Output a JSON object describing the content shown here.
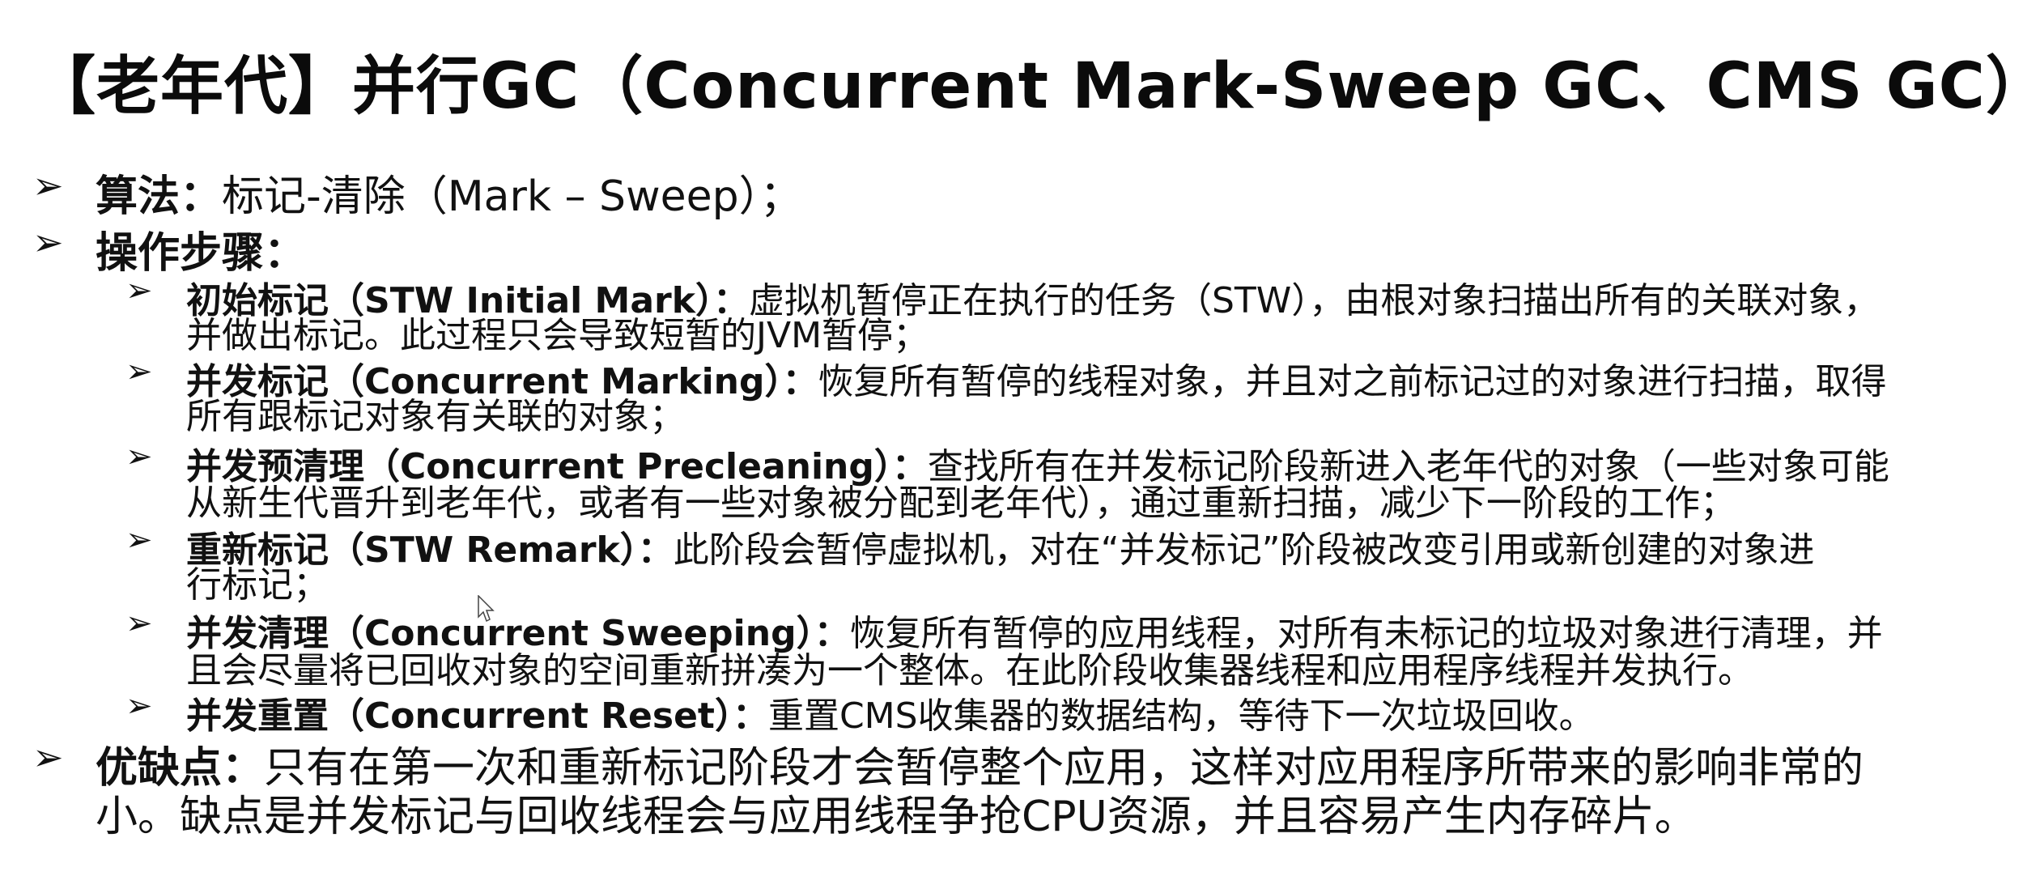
{
  "title": "【老年代】并行GC（Concurrent Mark-Sweep GC、CMS GC）",
  "bullet_glyph": "➢",
  "algorithm": {
    "label": "算法：",
    "text": "标记-清除（Mark – Sweep）；"
  },
  "steps_heading": {
    "label": "操作步骤："
  },
  "steps": [
    {
      "label": "初始标记（STW Initial Mark）：",
      "line1": "虚拟机暂停正在执行的任务（STW），由根对象扫描出所有的关联对象，",
      "line2": "并做出标记。此过程只会导致短暂的JVM暂停；"
    },
    {
      "label": "并发标记（Concurrent Marking）：",
      "line1": "恢复所有暂停的线程对象，并且对之前标记过的对象进行扫描，取得",
      "line2": "所有跟标记对象有关联的对象；"
    },
    {
      "label": "并发预清理（Concurrent Precleaning）：",
      "line1": "查找所有在并发标记阶段新进入老年代的对象（一些对象可能",
      "line2": "从新生代晋升到老年代，或者有一些对象被分配到老年代），通过重新扫描，减少下一阶段的工作；"
    },
    {
      "label": "重新标记（STW Remark）：",
      "line1": "此阶段会暂停虚拟机，对在“并发标记”阶段被改变引用或新创建的对象进",
      "line2": "行标记；"
    },
    {
      "label": "并发清理（Concurrent Sweeping）：",
      "line1": "恢复所有暂停的应用线程，对所有未标记的垃圾对象进行清理，并",
      "line2": "且会尽量将已回收对象的空间重新拼凑为一个整体。在此阶段收集器线程和应用程序线程并发执行。"
    },
    {
      "label": "并发重置（Concurrent Reset）：",
      "line1": "重置CMS收集器的数据结构，等待下一次垃圾回收。",
      "line2": ""
    }
  ],
  "pros_cons": {
    "label": "优缺点：",
    "line1": "只有在第一次和重新标记阶段才会暂停整个应用，这样对应用程序所带来的影响非常的",
    "line2": "小。缺点是并发标记与回收线程会与应用线程争抢CPU资源，并且容易产生内存碎片。"
  }
}
